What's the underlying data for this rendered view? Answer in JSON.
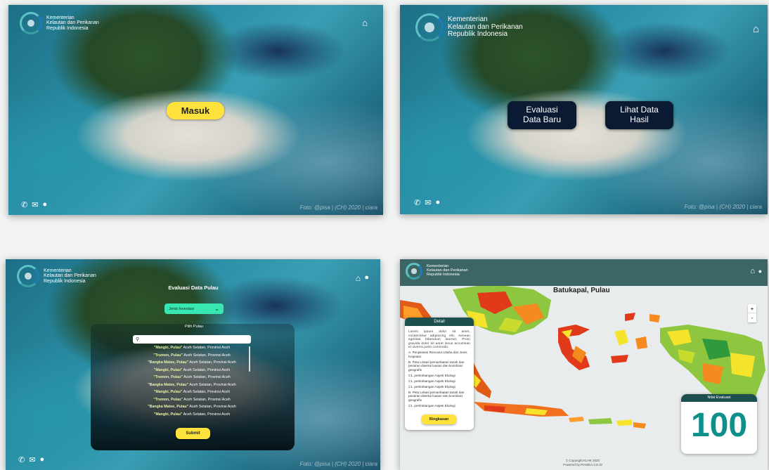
{
  "brand": {
    "line1": "Kementerian",
    "line2": "Kelautan dan Perikanan",
    "line3": "Republik Indonesia"
  },
  "photo_credit": "Foto: @pisa | (CH) 2020 | ciara",
  "panel1": {
    "login_button": "Masuk"
  },
  "panel2": {
    "evaluate_button": "Evaluasi Data Baru",
    "view_button": "Lihat Data Hasil"
  },
  "panel3": {
    "title": "Evaluasi Data Pulau",
    "select_value": "Jenis Investasi",
    "pick_label": "Pilih Pulau",
    "search_placeholder": "",
    "islands": [
      {
        "name": "\"Mangki, Pulau\"",
        "region": " Aceh Selatan, Provinsi Aceh"
      },
      {
        "name": "\"Trumon, Pulau\"",
        "region": " Aceh Selatan, Provinsi Aceh"
      },
      {
        "name": "\"Bangka Matee, Pulau\"",
        "region": " Aceh Selatan, Provinsi Aceh"
      },
      {
        "name": "\"Mangki, Pulau\"",
        "region": " Aceh Selatan, Provinsi Aceh"
      },
      {
        "name": "\"Trumon, Pulau\"",
        "region": " Aceh Selatan, Provinsi Aceh"
      },
      {
        "name": "\"Bangka Matee, Pulau\"",
        "region": " Aceh Selatan, Provinsi Aceh"
      },
      {
        "name": "\"Mangki, Pulau\"",
        "region": " Aceh Selatan, Provinsi Aceh"
      },
      {
        "name": "\"Trumon, Pulau\"",
        "region": " Aceh Selatan, Provinsi Aceh"
      },
      {
        "name": "\"Bangka Matee, Pulau\"",
        "region": " Aceh Selatan, Provinsi Aceh"
      },
      {
        "name": "\"Mangki, Pulau\"",
        "region": " Aceh Selatan, Provinsi Aceh"
      }
    ],
    "submit_button": "Submit"
  },
  "panel4": {
    "island_label": "Batukapal, Pulau",
    "zoom_in": "+",
    "zoom_out": "-",
    "detail": {
      "title": "Detail",
      "intro": "Lorem ipsum dolor sit amet, consectetur adipiscing elit. Aenean egestas bibendum laoreet. Proin gravida dolor sit amet lacus accumsan et viverra justo commodo.",
      "items": [
        "A. Penjelasan Rencana Usaha dan Jenis Kegiatan",
        "B. Peta Lokasi pemanfaatan tanah dan perairan disertai luasan dan koordinat geografis",
        "C1. pertimbangan Aspek Ekologi",
        "C1. pertimbangan Aspek Ekologi",
        "C1. pertimbangan Aspek Ekologi",
        "B. Peta Lokasi pemanfaatan tanah dan perairan disertai luasan dan koordinat geografis",
        "C1. pertimbangan Aspek Ekologi"
      ],
      "button": "Ringkasan"
    },
    "score_label": "Nilai Evaluasi",
    "score_value": "100",
    "footer1": "© Copyright KLHK 2020",
    "footer2": "Powered by PIAMEA.CO.ID"
  },
  "colors": {
    "accent_yellow": "#ffe23b",
    "dark_navy": "#0b1a33",
    "teal_header": "#3c6666",
    "score_teal": "#0d8f8a",
    "select_green": "#37e6b0"
  }
}
